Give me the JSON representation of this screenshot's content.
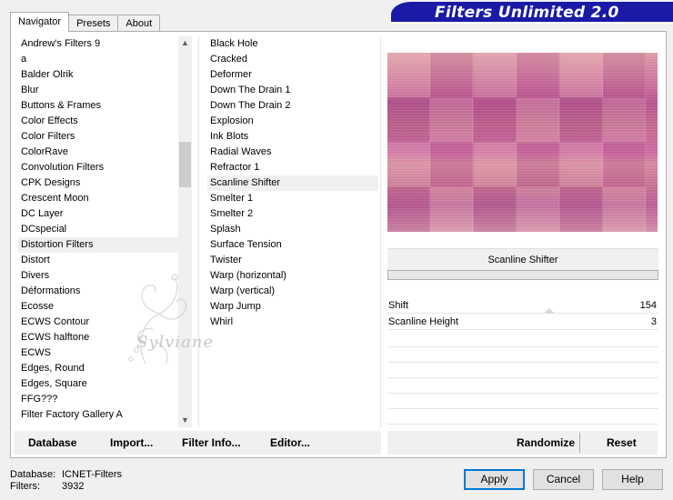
{
  "banner": {
    "title": "Filters Unlimited 2.0"
  },
  "tabs": [
    {
      "label": "Navigator",
      "active": true
    },
    {
      "label": "Presets",
      "active": false
    },
    {
      "label": "About",
      "active": false
    }
  ],
  "categories": {
    "selected": "Distortion Filters",
    "items": [
      "Andrew's Filters 9",
      "a",
      "Balder Olrik",
      "Blur",
      "Buttons & Frames",
      "Color Effects",
      "Color Filters",
      "ColorRave",
      "Convolution Filters",
      "CPK Designs",
      "Crescent Moon",
      "DC Layer",
      "DCspecial",
      "Distortion Filters",
      "Distort",
      "Divers",
      "Déformations",
      "Ecosse",
      "ECWS Contour",
      "ECWS halftone",
      "ECWS",
      "Edges, Round",
      "Edges, Square",
      "FFG???",
      "Filter Factory Gallery A"
    ]
  },
  "filters": {
    "selected": "Scanline Shifter",
    "items": [
      "Black Hole",
      "Cracked",
      "Deformer",
      "Down The Drain 1",
      "Down The Drain 2",
      "Explosion",
      "Ink Blots",
      "Radial Waves",
      "Refractor 1",
      "Scanline Shifter",
      "Smelter 1",
      "Smelter 2",
      "Splash",
      "Surface Tension",
      "Twister",
      "Warp (horizontal)",
      "Warp (vertical)",
      "Warp Jump",
      "Whirl"
    ]
  },
  "watermark": {
    "text": "Sylviane"
  },
  "settings": {
    "title": "Scanline Shifter",
    "params": [
      {
        "name": "Shift",
        "value": "154"
      },
      {
        "name": "Scanline Height",
        "value": "3"
      }
    ]
  },
  "links": {
    "database": "Database",
    "import": "Import...",
    "filter_info": "Filter Info...",
    "editor": "Editor..."
  },
  "actions": {
    "randomize": "Randomize",
    "reset": "Reset"
  },
  "footer": {
    "database_label": "Database:",
    "database_value": "ICNET-Filters",
    "filters_label": "Filters:",
    "filters_value": "3932"
  },
  "buttons": {
    "apply": "Apply",
    "cancel": "Cancel",
    "help": "Help"
  },
  "colors": {
    "banner": "#1a1aa6",
    "preview_pink": "#c86a9a",
    "accent": "#0078d7"
  },
  "icons": [
    "scroll-up-arrow-icon",
    "scroll-down-arrow-icon",
    "watermark-flourish-icon"
  ]
}
